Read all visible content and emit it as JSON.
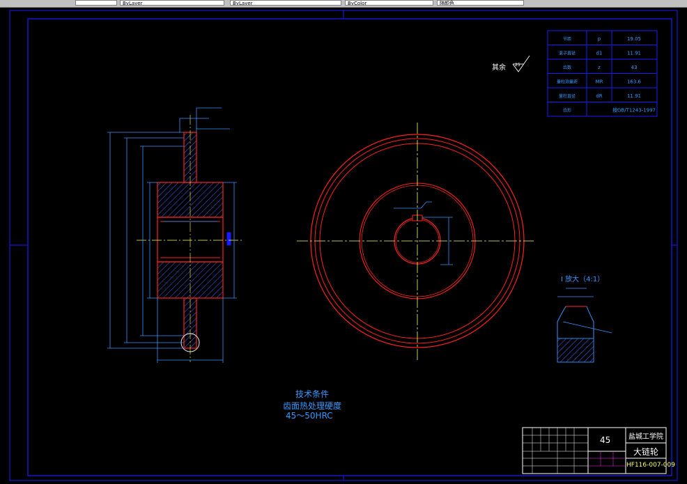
{
  "toolbar": {
    "field1": "ByLayer",
    "field2": "ByLayer",
    "field3": "ByColor",
    "field4": "随颜色"
  },
  "params": {
    "rows": [
      {
        "name": "节距",
        "symbol": "p",
        "value": "19.05"
      },
      {
        "name": "滚子直径",
        "symbol": "d1",
        "value": "11.91"
      },
      {
        "name": "齿数",
        "symbol": "z",
        "value": "43"
      },
      {
        "name": "量柱测量距",
        "symbol": "MR",
        "value": "163.6"
      },
      {
        "name": "量柱直径",
        "symbol": "dR",
        "value": "11.91"
      },
      {
        "name": "齿形",
        "symbol": "",
        "value": "按GB/T1243-1997"
      }
    ]
  },
  "roughness_note": "其余",
  "detail_title": "I 放大（4:1）",
  "tech": {
    "title": "技术条件",
    "line1": "齿面热处理硬度",
    "line2": "45～50HRC"
  },
  "title_block": {
    "material": "45",
    "school": "盐城工学院",
    "part_name": "大链轮",
    "drawing_no": "HF116-007-009"
  },
  "colors": {
    "frame": "#1a1aff",
    "part": "#ff2020",
    "centerline": "#ffff66",
    "dimension": "#3399ff",
    "text_white": "#ffffff",
    "title_magenta": "#ff33ff"
  }
}
